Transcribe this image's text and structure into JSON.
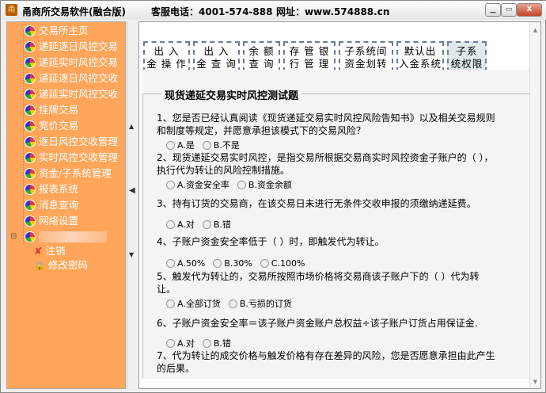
{
  "titlebar": {
    "app_title": "甬商所交易软件(融合版)",
    "hotline": "客服电话：4001-574-888",
    "website": "网址：www.574888.cn",
    "minimize": "▁",
    "maximize": "▭",
    "close": "X"
  },
  "sidebar": {
    "items": [
      {
        "label": "交易所主页"
      },
      {
        "label": "递延逐日风控交易"
      },
      {
        "label": "递延实时风控交易"
      },
      {
        "label": "递延逐日风控交收"
      },
      {
        "label": "递延实时风控交收"
      },
      {
        "label": "挂牌交易"
      },
      {
        "label": "竞价交易"
      },
      {
        "label": "逐日风控交收管理"
      },
      {
        "label": "实时风控交收管理"
      },
      {
        "label": "资金/子系统管理"
      },
      {
        "label": "报表系统"
      },
      {
        "label": "消息查询"
      },
      {
        "label": "网络设置"
      }
    ],
    "user_children": [
      {
        "label": "注销"
      },
      {
        "label": "修改密码"
      }
    ],
    "expand": "⊟"
  },
  "toolbar": {
    "buttons": [
      {
        "l1": "出 入",
        "l2": "金 操 作"
      },
      {
        "l1": "出 入",
        "l2": "金 查 询"
      },
      {
        "l1": "余 额",
        "l2": "查 询"
      },
      {
        "l1": "存 管 银",
        "l2": "行 管 理"
      },
      {
        "l1": "子系统间",
        "l2": "资金划转"
      },
      {
        "l1": "默认出",
        "l2": "入金系统"
      },
      {
        "l1": "子系",
        "l2": "统权限"
      }
    ]
  },
  "quiz": {
    "title": "现货递延交易实时风控测试题",
    "questions": [
      {
        "text": "1、您是否已经认真阅读《现货递延交易实时风控风险告知书》以及相关交易规则和制度等规定，并愿意承担该模式下的交易风险？",
        "options": [
          "A.是",
          "B.不是"
        ]
      },
      {
        "text": "2、现货递延交易实时风控，是指交易所根据交易商实时风控资金子账户的（ ），执行代为转让的风险控制措施。",
        "options": [
          "A.资金安全率",
          "B.资金余额"
        ]
      },
      {
        "text": "3、持有订货的交易商，在该交易日未进行无条件交收申报的须缴纳递延费。",
        "options": [
          "A.对",
          "B.错"
        ]
      },
      {
        "text": "4、子账户资金安全率低于（ ）时，即触发代为转让。",
        "options": [
          "A.50%",
          "B.30%",
          "C.100%"
        ]
      },
      {
        "text": "5、触发代为转让的，交易所按照市场价格将交易商该子账户下的（ ）代为转让。",
        "options": [
          "A.全部订货",
          "B.亏损的订货"
        ]
      },
      {
        "text": "6、子账户资金安全率＝该子账户资金账户总权益÷该子账户订货占用保证金.",
        "options": [
          "A.对",
          "B.错"
        ]
      },
      {
        "text": "7、代为转让的成交价格与触发价格有存在差异的风险，您是否愿意承担由此产生的后果。",
        "options": []
      }
    ]
  }
}
